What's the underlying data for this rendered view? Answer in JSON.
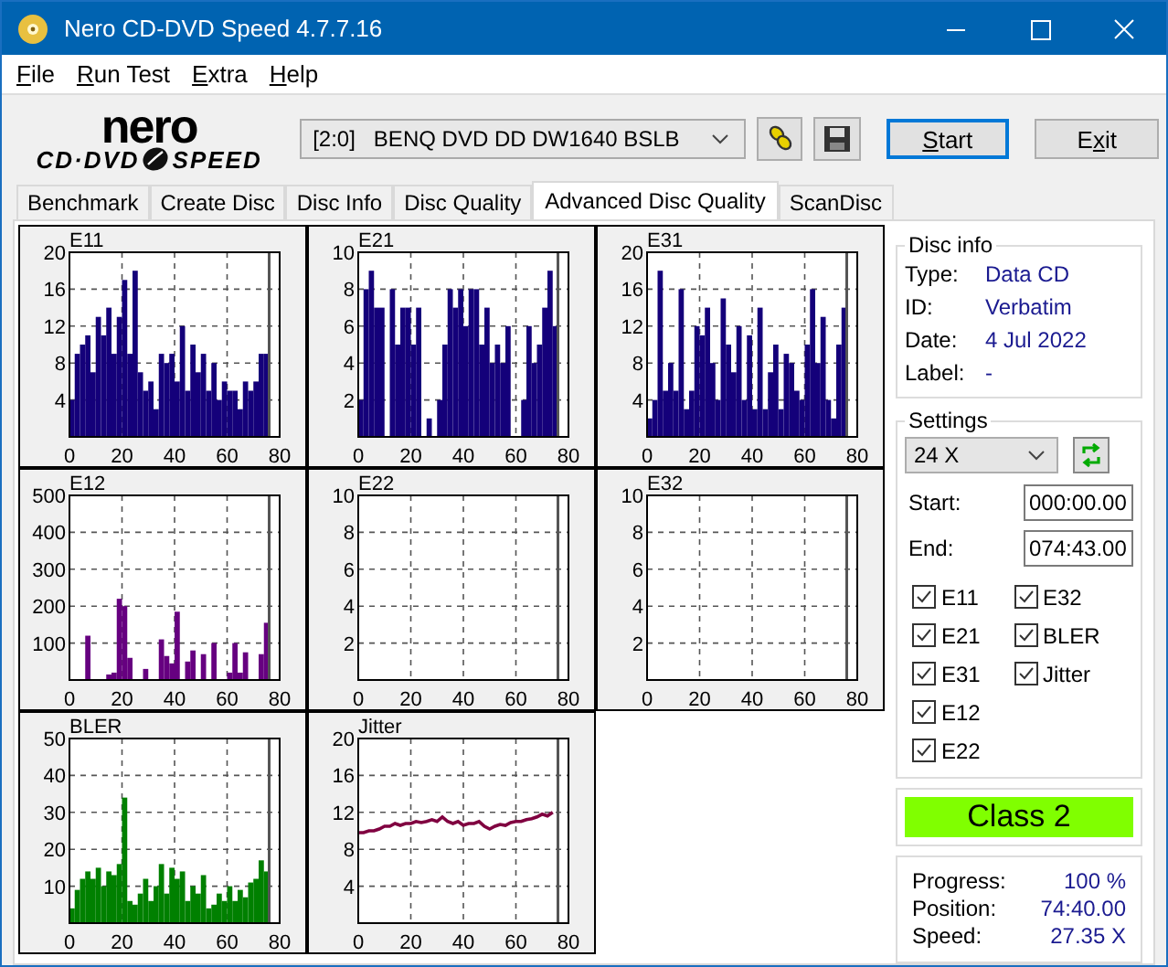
{
  "window": {
    "title": "Nero CD-DVD Speed 4.7.7.16"
  },
  "menu": [
    {
      "label": "File"
    },
    {
      "label": "Run Test"
    },
    {
      "label": "Extra"
    },
    {
      "label": "Help"
    }
  ],
  "logo": {
    "top": "nero",
    "left": "CD·DVD",
    "right": "SPEED"
  },
  "toolbar": {
    "drive": "[2:0]   BENQ DVD DD DW1640 BSLB",
    "start": {
      "label": "Start"
    },
    "exit": {
      "label": "Exit"
    }
  },
  "tabs": [
    {
      "label": "Benchmark",
      "selected": false
    },
    {
      "label": "Create Disc",
      "selected": false
    },
    {
      "label": "Disc Info",
      "selected": false
    },
    {
      "label": "Disc Quality",
      "selected": false
    },
    {
      "label": "Advanced Disc Quality",
      "selected": true
    },
    {
      "label": "ScanDisc",
      "selected": false
    }
  ],
  "charts": [
    {
      "chart_data": {
        "type": "bar",
        "title": "E11",
        "x": [
          0,
          2,
          4,
          6,
          8,
          10,
          12,
          14,
          16,
          18,
          20,
          22,
          24,
          26,
          28,
          30,
          32,
          34,
          36,
          38,
          40,
          42,
          44,
          46,
          48,
          50,
          52,
          54,
          56,
          58,
          60,
          62,
          64,
          66,
          68,
          70,
          72,
          74
        ],
        "series": [
          {
            "color": "#14007a",
            "values": [
              4,
              9,
              10,
              11,
              7,
              13,
              11,
              14,
              9,
              13,
              17,
              9,
              18,
              7,
              5,
              6,
              3,
              9,
              8,
              9,
              6,
              12,
              5,
              10,
              7,
              9,
              5,
              8,
              4,
              6,
              5,
              5,
              3,
              6,
              5,
              6,
              9,
              9
            ]
          }
        ],
        "xlim": [
          0,
          80
        ],
        "ylim": [
          0,
          20
        ],
        "xticks": [
          0,
          20,
          40,
          60,
          80
        ],
        "yticks": [
          4,
          8,
          12,
          16,
          20
        ],
        "grid": true,
        "ref_lines": [
          {
            "axis": "x",
            "value": 76
          }
        ]
      }
    },
    {
      "chart_data": {
        "type": "bar",
        "title": "E21",
        "x": [
          0,
          2,
          4,
          6,
          8,
          12,
          14,
          16,
          18,
          20,
          22,
          26,
          30,
          32,
          34,
          36,
          38,
          40,
          42,
          44,
          46,
          48,
          50,
          52,
          54,
          56,
          62,
          64,
          66,
          68,
          70,
          72,
          74
        ],
        "series": [
          {
            "color": "#14007a",
            "values": [
              2,
              8,
              9,
              7,
              7,
              8,
              5,
              7,
              7,
              5,
              7,
              1,
              2,
              5,
              8,
              7,
              8,
              6,
              8,
              8,
              5,
              7,
              4,
              5,
              4,
              6,
              2,
              6,
              4,
              5,
              7,
              9,
              6
            ]
          }
        ],
        "xlim": [
          0,
          80
        ],
        "ylim": [
          0,
          10
        ],
        "xticks": [
          0,
          20,
          40,
          60,
          80
        ],
        "yticks": [
          2,
          4,
          6,
          8,
          10
        ],
        "grid": true,
        "ref_lines": [
          {
            "axis": "x",
            "value": 76
          }
        ]
      }
    },
    {
      "chart_data": {
        "type": "bar",
        "title": "E31",
        "x": [
          0,
          2,
          4,
          6,
          8,
          10,
          12,
          14,
          16,
          18,
          20,
          22,
          24,
          26,
          28,
          30,
          32,
          34,
          36,
          38,
          40,
          42,
          44,
          46,
          48,
          50,
          52,
          54,
          56,
          58,
          60,
          62,
          64,
          66,
          68,
          70,
          72,
          74
        ],
        "series": [
          {
            "color": "#14007a",
            "values": [
              2,
              4,
              18,
              5,
              8,
              5,
              16,
              3,
              5,
              12,
              11,
              14,
              8,
              4,
              15,
              10,
              7,
              12,
              4,
              11,
              3,
              14,
              3,
              7,
              10,
              3,
              9,
              8,
              5,
              4,
              10,
              16,
              8,
              13,
              4,
              2,
              10,
              14
            ]
          }
        ],
        "xlim": [
          0,
          80
        ],
        "ylim": [
          0,
          20
        ],
        "xticks": [
          0,
          20,
          40,
          60,
          80
        ],
        "yticks": [
          4,
          8,
          12,
          16,
          20
        ],
        "grid": true,
        "ref_lines": [
          {
            "axis": "x",
            "value": 76
          }
        ]
      }
    },
    {
      "chart_data": {
        "type": "bar",
        "title": "E12",
        "x": [
          6,
          14,
          16,
          18,
          20,
          22,
          28,
          34,
          36,
          38,
          40,
          44,
          46,
          50,
          54,
          60,
          62,
          64,
          66,
          72,
          74
        ],
        "series": [
          {
            "color": "#660080",
            "values": [
              120,
              15,
              20,
              220,
              200,
              60,
              30,
              110,
              65,
              45,
              185,
              50,
              80,
              70,
              100,
              20,
              100,
              20,
              75,
              70,
              155
            ]
          }
        ],
        "xlim": [
          0,
          80
        ],
        "ylim": [
          0,
          500
        ],
        "xticks": [
          0,
          20,
          40,
          60,
          80
        ],
        "yticks": [
          100,
          200,
          300,
          400,
          500
        ],
        "grid": true,
        "ref_lines": [
          {
            "axis": "x",
            "value": 76
          }
        ]
      }
    },
    {
      "chart_data": {
        "type": "bar",
        "title": "E22",
        "xlim": [
          0,
          80
        ],
        "ylim": [
          0,
          10
        ],
        "xticks": [
          0,
          20,
          40,
          60,
          80
        ],
        "yticks": [
          2,
          4,
          6,
          8,
          10
        ],
        "grid": true,
        "ref_lines": [
          {
            "axis": "x",
            "value": 76
          }
        ]
      }
    },
    {
      "chart_data": {
        "type": "bar",
        "title": "E32",
        "xlim": [
          0,
          80
        ],
        "ylim": [
          0,
          10
        ],
        "xticks": [
          0,
          20,
          40,
          60,
          80
        ],
        "yticks": [
          2,
          4,
          6,
          8,
          10
        ],
        "grid": true,
        "ref_lines": [
          {
            "axis": "x",
            "value": 76
          }
        ]
      }
    },
    {
      "chart_data": {
        "type": "bar",
        "title": "BLER",
        "x": [
          0,
          2,
          4,
          6,
          8,
          10,
          12,
          14,
          16,
          18,
          20,
          22,
          24,
          26,
          28,
          30,
          32,
          34,
          36,
          38,
          40,
          42,
          44,
          46,
          48,
          50,
          52,
          54,
          56,
          58,
          60,
          62,
          64,
          66,
          68,
          70,
          72,
          74
        ],
        "series": [
          {
            "color": "#008000",
            "values": [
              4,
              9,
              12,
              14,
              12,
              15,
              10,
              14,
              13,
              16,
              34,
              6,
              5,
              8,
              12,
              6,
              10,
              16,
              8,
              15,
              12,
              14,
              6,
              10,
              8,
              13,
              4,
              5,
              8,
              6,
              10,
              6,
              9,
              7,
              11,
              12,
              17,
              14
            ]
          }
        ],
        "xlim": [
          0,
          80
        ],
        "ylim": [
          0,
          50
        ],
        "xticks": [
          0,
          20,
          40,
          60,
          80
        ],
        "yticks": [
          10,
          20,
          30,
          40,
          50
        ],
        "grid": true,
        "ref_lines": [
          {
            "axis": "x",
            "value": 76
          }
        ]
      }
    },
    {
      "chart_data": {
        "type": "line",
        "title": "Jitter",
        "x": [
          0,
          2,
          4,
          6,
          8,
          10,
          12,
          14,
          16,
          18,
          20,
          22,
          24,
          26,
          28,
          30,
          32,
          34,
          36,
          38,
          40,
          42,
          44,
          46,
          48,
          50,
          52,
          54,
          56,
          58,
          60,
          62,
          64,
          66,
          68,
          70,
          72,
          74
        ],
        "series": [
          {
            "color": "#800040",
            "values": [
              9.8,
              9.8,
              10,
              10,
              10.2,
              10.5,
              10.5,
              10.8,
              10.6,
              10.8,
              10.8,
              11,
              10.9,
              11,
              11.2,
              11,
              11.5,
              11,
              10.8,
              11,
              10.6,
              10.8,
              10.8,
              11,
              10.5,
              10.2,
              10.5,
              10.7,
              10.6,
              10.9,
              11,
              11,
              11.2,
              11.3,
              11.5,
              11.8,
              11.6,
              12
            ]
          }
        ],
        "xlim": [
          0,
          80
        ],
        "ylim": [
          0,
          20
        ],
        "xticks": [
          0,
          20,
          40,
          60,
          80
        ],
        "yticks": [
          4,
          8,
          12,
          16,
          20
        ],
        "grid": true,
        "ref_lines": [
          {
            "axis": "x",
            "value": 76
          }
        ]
      }
    }
  ],
  "disc_info": {
    "title": "Disc info",
    "fields": [
      {
        "label": "Type:",
        "value": "Data CD"
      },
      {
        "label": "ID:",
        "value": "Verbatim"
      },
      {
        "label": "Date:",
        "value": "4 Jul 2022"
      },
      {
        "label": "Label:",
        "value": "-"
      }
    ]
  },
  "settings": {
    "title": "Settings",
    "speed": "24 X",
    "start_label": "Start:",
    "start": "000:00.00",
    "end_label": "End:",
    "end": "074:43.00",
    "options": [
      {
        "label": "E11",
        "checked": true
      },
      {
        "label": "E21",
        "checked": true
      },
      {
        "label": "E31",
        "checked": true
      },
      {
        "label": "E12",
        "checked": true
      },
      {
        "label": "E22",
        "checked": true
      },
      {
        "label": "E32",
        "checked": true
      },
      {
        "label": "BLER",
        "checked": true
      },
      {
        "label": "Jitter",
        "checked": true
      }
    ]
  },
  "result": {
    "label": "Class 2",
    "color": "#80ff00"
  },
  "status": [
    {
      "label": "Progress:",
      "value": "100 %"
    },
    {
      "label": "Position:",
      "value": "74:40.00"
    },
    {
      "label": "Speed:",
      "value": "27.35 X"
    }
  ]
}
